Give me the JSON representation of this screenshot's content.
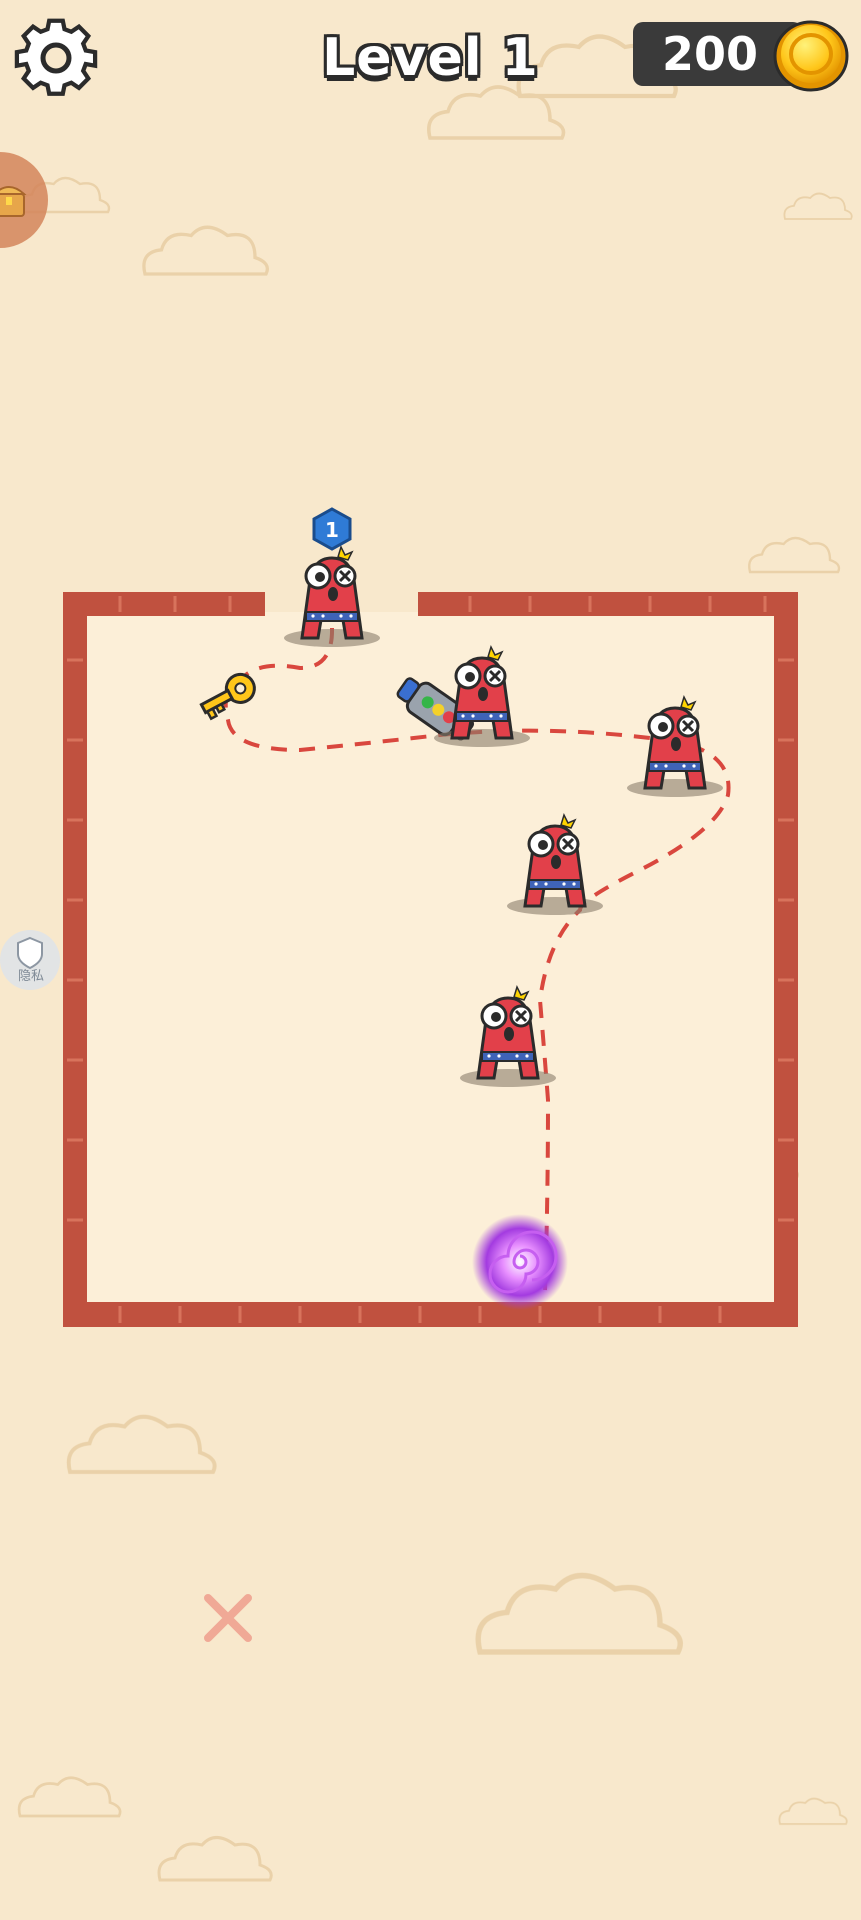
{
  "hud": {
    "level_label": "Level 1",
    "coins": "200",
    "settings_icon": "gear-icon",
    "coin_icon": "gold-coin-icon",
    "chest_icon": "treasure-chest-icon"
  },
  "privacy": {
    "label": "隐私",
    "icon": "shield-icon"
  },
  "board": {
    "wall_color": "#c0513f",
    "floor_color": "#fcefd8"
  },
  "characters": [
    {
      "type": "alphabet-A-monster",
      "badge": "1"
    },
    {
      "type": "alphabet-A-monster"
    },
    {
      "type": "alphabet-A-monster"
    },
    {
      "type": "alphabet-A-monster"
    },
    {
      "type": "alphabet-A-monster"
    }
  ],
  "items": {
    "key_icon": "golden-key-icon",
    "weapon_icon": "gauntlet-weapon-icon",
    "portal_icon": "purple-portal-icon"
  },
  "path_color": "#d9473e",
  "close_icon": "close-icon"
}
